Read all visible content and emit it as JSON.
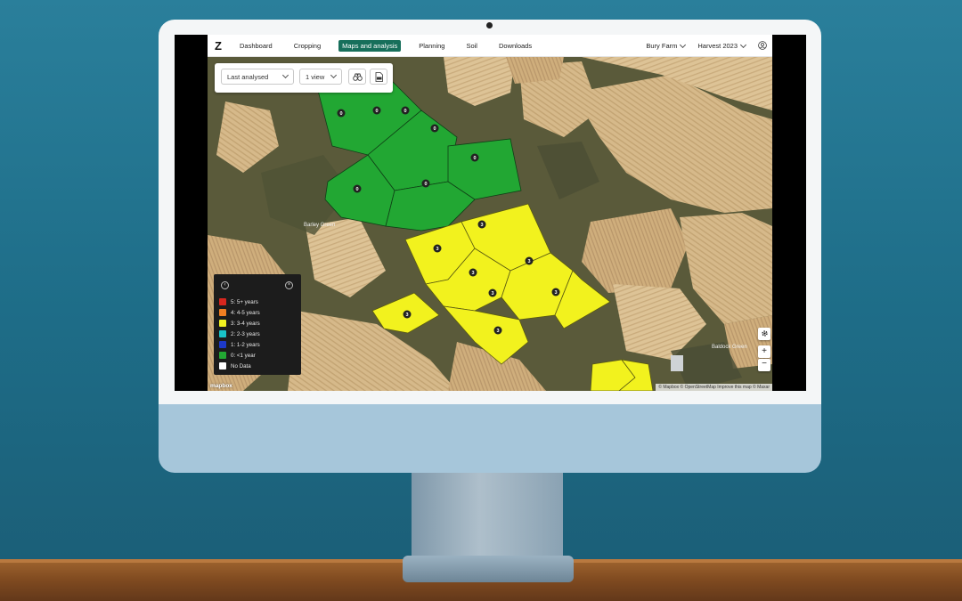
{
  "nav": {
    "logo": "Z",
    "items": [
      {
        "label": "Dashboard",
        "active": false
      },
      {
        "label": "Cropping",
        "active": false
      },
      {
        "label": "Maps and analysis",
        "active": true
      },
      {
        "label": "Planning",
        "active": false
      },
      {
        "label": "Soil",
        "active": false
      },
      {
        "label": "Downloads",
        "active": false
      }
    ],
    "farm": "Bury Farm",
    "season": "Harvest 2023"
  },
  "toolbar": {
    "analysis_select": "Last analysed",
    "view_select": "1 view",
    "compare_icon": "binoculars-icon",
    "pdf_icon": "pdf-export-icon"
  },
  "legend": {
    "items": [
      {
        "label": "5: 5+ years",
        "color": "#d7261e"
      },
      {
        "label": "4: 4-5 years",
        "color": "#f07f22"
      },
      {
        "label": "3: 3-4 years",
        "color": "#f0f020"
      },
      {
        "label": "2: 2-3 years",
        "color": "#19c3c8"
      },
      {
        "label": "1: 1-2 years",
        "color": "#1d39c8"
      },
      {
        "label": "0: <1 year",
        "color": "#22a733"
      },
      {
        "label": "No Data",
        "color": "#ffffff"
      }
    ]
  },
  "map": {
    "field_value_green": "0",
    "field_value_yellow": "3",
    "place_label_left": "Barley Green",
    "place_label_right": "Baldock Green",
    "attribution": "© Mapbox © OpenStreetMap  Improve this map © Maxar",
    "mapbox_logo": "mapbox",
    "zoom_in": "+",
    "zoom_out": "−"
  },
  "colors": {
    "green_field": "#22a733",
    "yellow_field": "#f2f21e",
    "nav_active": "#176f5b"
  }
}
